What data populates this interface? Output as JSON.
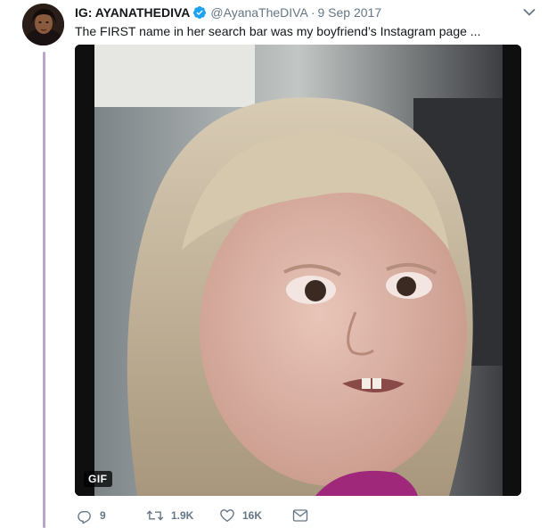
{
  "tweet": {
    "author_name": "IG: AYANATHEDIVA",
    "handle": "@AyanaTheDIVA",
    "separator": "·",
    "date": "9 Sep 2017",
    "text": "The FIRST name in her search bar was my boyfriend’s Instagram page ...",
    "media": {
      "type": "gif",
      "badge": "GIF"
    },
    "actions": {
      "replies": "9",
      "retweets": "1.9K",
      "likes": "16K"
    }
  },
  "colors": {
    "verified": "#1da1f2",
    "thread_line": "#b7a7c4",
    "muted_text": "#657786"
  },
  "icons": [
    "verified-badge-icon",
    "chevron-down-icon",
    "reply-icon",
    "retweet-icon",
    "like-icon",
    "direct-message-icon"
  ]
}
